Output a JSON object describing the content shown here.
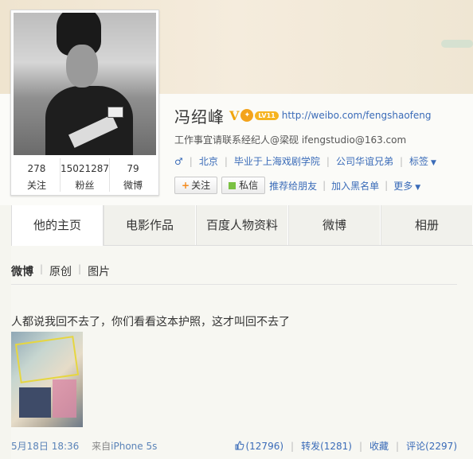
{
  "profile": {
    "name": "冯绍峰",
    "verified_mark": "V",
    "level_badge": "LV11",
    "homepage_url": "http://weibo.com/fengshaofeng",
    "intro": "工作事宜请联系经纪人@梁砚 ifengstudio@163.com",
    "gender_symbol": "♂",
    "location": "北京",
    "education": "毕业于上海戏剧学院",
    "company": "公司华谊兄弟",
    "tags_label": "标签"
  },
  "stats": [
    {
      "num": "278",
      "label": "关注"
    },
    {
      "num": "15021287",
      "label": "粉丝"
    },
    {
      "num": "79",
      "label": "微博"
    }
  ],
  "actions": {
    "follow": "关注",
    "message": "私信",
    "recommend": "推荐给朋友",
    "blacklist": "加入黑名单",
    "more": "更多"
  },
  "tabs": [
    "他的主页",
    "电影作品",
    "百度人物资料",
    "微博",
    "相册"
  ],
  "feed_filter": [
    "微博",
    "原创",
    "图片"
  ],
  "post": {
    "text": "人都说我回不去了，你们看看这本护照，这才叫回不去了",
    "time": "5月18日 18:36",
    "source_prefix": "来自",
    "source": "iPhone 5s",
    "likes": "(12796)",
    "repost": "转发(1281)",
    "favorite": "收藏",
    "comment": "评论(2297)"
  },
  "colors": {
    "link": "#3a6bb8",
    "follow_plus": "#f48a1c",
    "message_square": "#7ac143",
    "vip": "#f0a50d"
  }
}
